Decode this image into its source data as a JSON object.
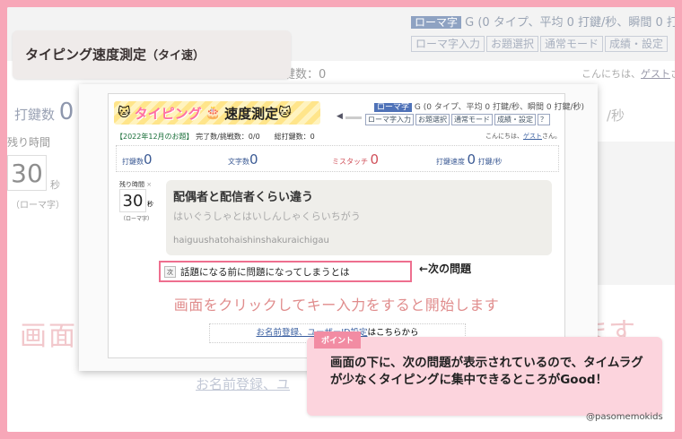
{
  "background_page": {
    "status_tag": "ローマ字",
    "status_text": "G (0 タイプ、平均 0 打鍵/秒、瞬間 0 打鍵/秒",
    "buttons": [
      "ローマ字入力",
      "お題選択",
      "通常モード",
      "成績・設定"
    ],
    "stroke_line": "打鍵数：0",
    "hello_text": "こんにちは、",
    "hello_link": "ゲスト",
    "hello_suffix": "さん",
    "strokes_label": "打鍵数",
    "strokes_value": "0",
    "remain_label": "残り時間",
    "timer_value": "30",
    "timer_unit": "秒",
    "timer_mode": "（ローマ字）",
    "click_msg": "画面",
    "click_msg_right": "ます",
    "register_link": "お名前登録、ユ",
    "right_unit": "/秒"
  },
  "title_card": {
    "title": "タイピング速度測定",
    "subtitle": "（タイ速）"
  },
  "app": {
    "logo_text_left": "タイピング",
    "logo_text_right": "速度測定",
    "mode_tag": "ローマ字",
    "mode_status": "G (0 タイプ、平均 0 打鍵/秒、瞬間 0 打鍵/秒)",
    "buttons": [
      "ローマ字入力",
      "お題選択",
      "通常モード",
      "成績・設定",
      "？"
    ],
    "info_prefix": "【2022年12月のお題】",
    "info_text": "完了数/挑戦数：0/0　　総打鍵数：0",
    "hello_text": "こんにちは、",
    "hello_link": "ゲスト",
    "hello_suffix": "さん。",
    "stats": [
      {
        "label": "打鍵数",
        "value": "0",
        "unit": ""
      },
      {
        "label": "文字数",
        "value": "0",
        "unit": ""
      },
      {
        "label": "ミスタッチ",
        "value": "0",
        "unit": ""
      },
      {
        "label": "打鍵速度",
        "value": "0",
        "unit": "打鍵/秒"
      }
    ],
    "remain_label": "残り時間",
    "remain_close": "×",
    "timer_value": "30",
    "timer_unit": "秒",
    "timer_mode": "（ローマ字）",
    "question_kanji": "配偶者と配信者くらい違う",
    "question_kana": "はいぐうしゃとはいしんしゃくらいちがう",
    "question_romaji": "haiguushatohaishinshakuraichigau",
    "next_tag": "次",
    "next_text": "話題になる前に問題になってしまうとは",
    "next_annotation": "←次の問題",
    "click_msg": "画面をクリックしてキー入力をすると開始します",
    "register_link": "お名前登録、ユーザーID設定",
    "register_suffix": "はこちらから"
  },
  "point": {
    "tag": "ポイント",
    "text": "画面の下に、次の問題が表示されているので、タイムラグが少なくタイピングに集中できるところがGood！"
  },
  "handle": "@pasomemokids",
  "colors": {
    "pink_frame": "#f7a7b8",
    "accent_blue": "#4f72b8",
    "miss_red": "#d0505a",
    "highlight_pink": "#ee6f8f"
  }
}
